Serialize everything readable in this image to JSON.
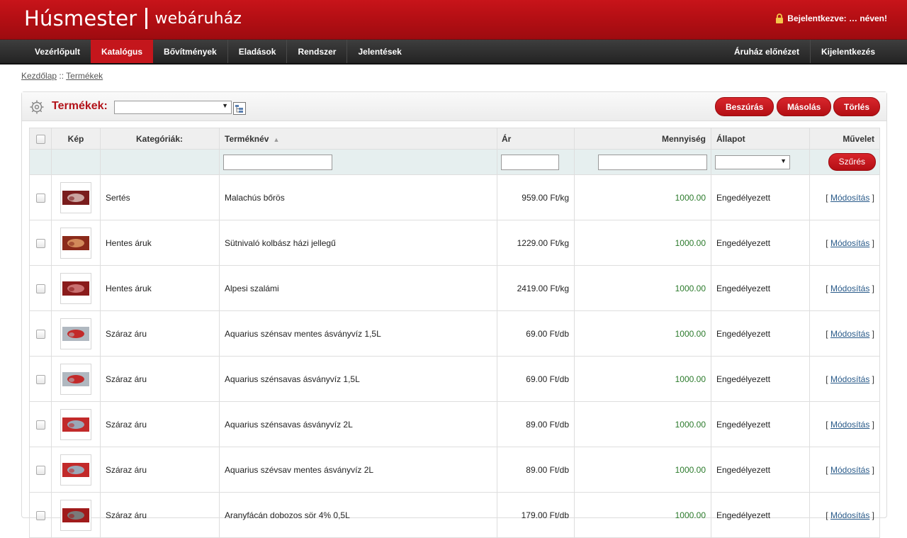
{
  "header": {
    "brand_main": "Húsmester",
    "brand_sub": "webáruház",
    "login_text": "Bejelentkezve: … néven!"
  },
  "nav": {
    "left": [
      "Vezérlőpult",
      "Katalógus",
      "Bővítmények",
      "Eladások",
      "Rendszer",
      "Jelentések"
    ],
    "active": "Katalógus",
    "right": [
      "Áruház előnézet",
      "Kijelentkezés"
    ]
  },
  "breadcrumb": {
    "home": "Kezdőlap",
    "sep": " :: ",
    "current": "Termékek"
  },
  "panel": {
    "title": "Termékek:",
    "buttons": {
      "insert": "Beszúrás",
      "copy": "Másolás",
      "delete": "Törlés"
    }
  },
  "table": {
    "columns": [
      "Kép",
      "Kategóriák:",
      "Terméknév",
      "Ár",
      "Mennyiség",
      "Állapot",
      "Művelet"
    ],
    "filter_button": "Szűrés",
    "action_label": "Módosítás",
    "rows": [
      {
        "category": "Sertés",
        "name": "Malachús bőrös",
        "price": "959.00 Ft/kg",
        "qty": "1000.00",
        "status": "Engedélyezett"
      },
      {
        "category": "Hentes áruk",
        "name": "Sütnivaló kolbász házi jellegű",
        "price": "1229.00 Ft/kg",
        "qty": "1000.00",
        "status": "Engedélyezett"
      },
      {
        "category": "Hentes áruk",
        "name": "Alpesi szalámi",
        "price": "2419.00 Ft/kg",
        "qty": "1000.00",
        "status": "Engedélyezett"
      },
      {
        "category": "Száraz áru",
        "name": "Aquarius szénsav mentes ásványvíz 1,5L",
        "price": "69.00 Ft/db",
        "qty": "1000.00",
        "status": "Engedélyezett"
      },
      {
        "category": "Száraz áru",
        "name": "Aquarius szénsavas ásványvíz 1,5L",
        "price": "69.00 Ft/db",
        "qty": "1000.00",
        "status": "Engedélyezett"
      },
      {
        "category": "Száraz áru",
        "name": "Aquarius szénsavas ásványvíz 2L",
        "price": "89.00 Ft/db",
        "qty": "1000.00",
        "status": "Engedélyezett"
      },
      {
        "category": "Száraz áru",
        "name": "Aquarius szévsav mentes ásványvíz 2L",
        "price": "89.00 Ft/db",
        "qty": "1000.00",
        "status": "Engedélyezett"
      },
      {
        "category": "Száraz áru",
        "name": "Aranyfácán dobozos sör 4% 0,5L",
        "price": "179.00 Ft/db",
        "qty": "1000.00",
        "status": "Engedélyezett"
      }
    ]
  },
  "colors": {
    "brand_red": "#b50f14",
    "nav_dark": "#2a2a2a",
    "qty_green": "#2b7a2b",
    "link_blue": "#2a5b8a"
  }
}
